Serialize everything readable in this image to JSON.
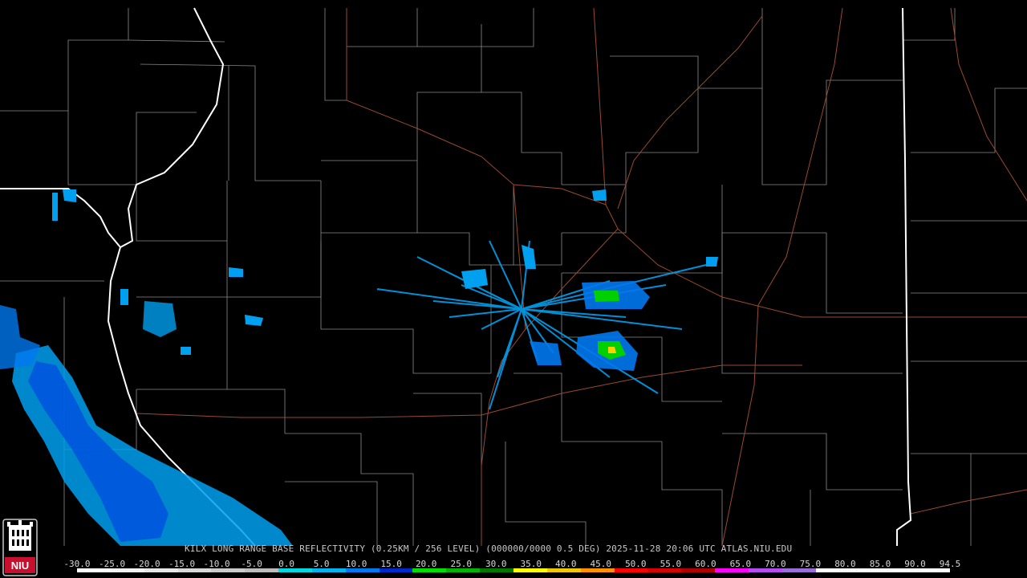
{
  "caption": "KILX LONG RANGE BASE REFLECTIVITY (0.25KM / 256 LEVEL) (000000/0000 0.5 DEG) 2025-11-28 20:06 UTC  ATLAS.NIU.EDU",
  "legend": {
    "ticks": [
      "-30.0",
      "-25.0",
      "-20.0",
      "-15.0",
      "-10.0",
      "-5.0",
      "0.0",
      "5.0",
      "10.0",
      "15.0",
      "20.0",
      "25.0",
      "30.0",
      "35.0",
      "40.0",
      "45.0",
      "50.0",
      "55.0",
      "60.0",
      "65.0",
      "70.0",
      "75.0",
      "80.0",
      "85.0",
      "90.0",
      "94.5"
    ],
    "colors": [
      "#ffffff",
      "#f4f4f4",
      "#e6e6e6",
      "#d8d8d8",
      "#cacaca",
      "#bcbcbc",
      "#00d8e0",
      "#00b4f0",
      "#0078f0",
      "#0028c8",
      "#00e000",
      "#00b400",
      "#007800",
      "#ffff00",
      "#f0c800",
      "#ff9000",
      "#ff0000",
      "#d80000",
      "#b00000",
      "#ff00ff",
      "#b44cf0",
      "#9a6ed6",
      "#ffffff",
      "#ffffff",
      "#ffffff",
      "#ffffff"
    ]
  },
  "logo": {
    "text": "NIU",
    "accent": "#c8102e"
  },
  "map_colors": {
    "county": "#8a8a8a",
    "state": "#ffffff",
    "road": "#9a4a30",
    "echo_light": "#00a0f0",
    "echo_mid": "#0050e0",
    "echo_strong": "#00d000",
    "echo_core": "#ffd000"
  }
}
